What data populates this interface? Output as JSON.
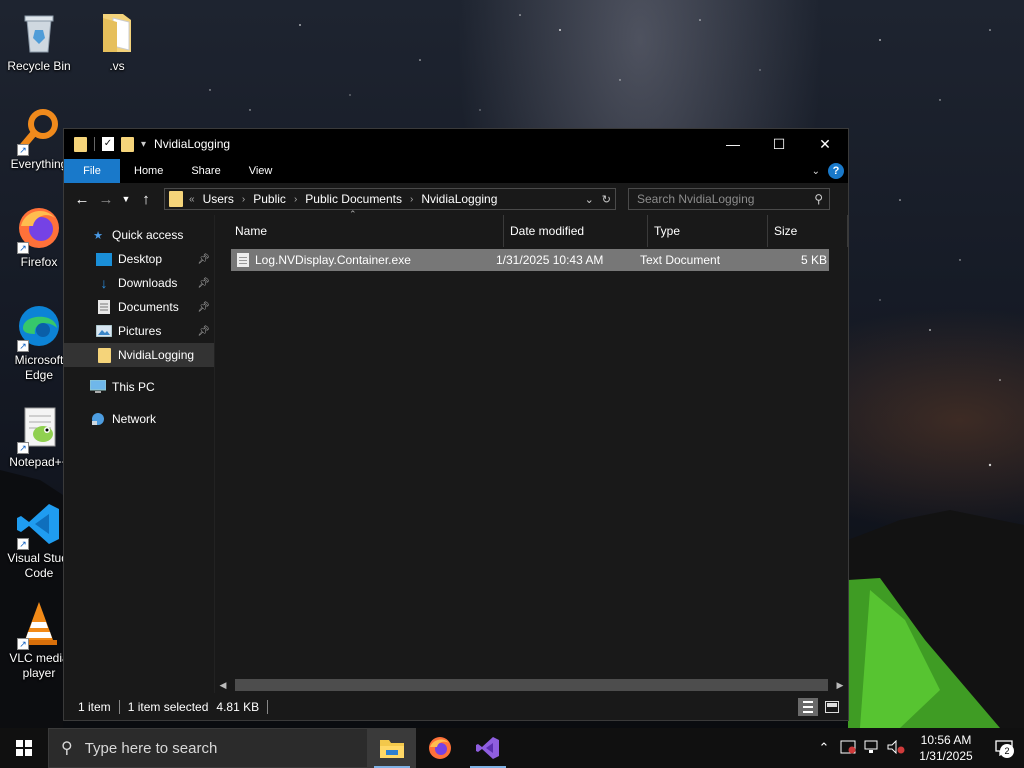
{
  "desktop": {
    "icons": [
      {
        "label": "Recycle Bin",
        "icon": "recycle-bin-icon"
      },
      {
        "label": ".vs",
        "icon": "folder-icon"
      },
      {
        "label": "Everything",
        "icon": "magnifier-icon"
      },
      {
        "label": "Firefox",
        "icon": "firefox-icon"
      },
      {
        "label": "Microsoft Edge",
        "label_line1": "Microsoft",
        "label_line2": "Edge",
        "icon": "edge-icon"
      },
      {
        "label": "Notepad++",
        "icon": "notepadpp-icon"
      },
      {
        "label": "Visual Studio Code",
        "label_line1": "Visual Studi",
        "label_line2": "Code",
        "icon": "vscode-icon"
      },
      {
        "label": "VLC media player",
        "label_line1": "VLC media",
        "label_line2": "player",
        "icon": "vlc-icon"
      }
    ]
  },
  "window": {
    "title": "NvidiaLogging",
    "controls": {
      "minimize": "—",
      "maximize": "☐",
      "close": "✕"
    }
  },
  "ribbon": {
    "tabs": [
      "File",
      "Home",
      "Share",
      "View"
    ],
    "help": "?"
  },
  "address_bar": {
    "overflow": "«",
    "path": [
      "Users",
      "Public",
      "Public Documents",
      "NvidiaLogging"
    ]
  },
  "search": {
    "placeholder": "Search NvidiaLogging"
  },
  "nav_pane": {
    "quick_access": "Quick access",
    "pinned": [
      {
        "label": "Desktop",
        "icon": "desktop-icon",
        "pinned": true
      },
      {
        "label": "Downloads",
        "icon": "downloads-icon",
        "pinned": true
      },
      {
        "label": "Documents",
        "icon": "documents-icon",
        "pinned": true
      },
      {
        "label": "Pictures",
        "icon": "pictures-icon",
        "pinned": true
      },
      {
        "label": "NvidiaLogging",
        "icon": "folder-icon",
        "pinned": false,
        "selected": true
      }
    ],
    "this_pc": "This PC",
    "network": "Network"
  },
  "file_list": {
    "columns": [
      "Name",
      "Date modified",
      "Type",
      "Size"
    ],
    "rows": [
      {
        "name": "Log.NVDisplay.Container.exe",
        "date_modified": "1/31/2025 10:43 AM",
        "type": "Text Document",
        "size": "5 KB",
        "selected": true
      }
    ]
  },
  "status_bar": {
    "item_count": "1 item",
    "selection": "1 item selected",
    "selection_size": "4.81 KB"
  },
  "taskbar": {
    "search_placeholder": "Type here to search",
    "apps": [
      "file-explorer-icon",
      "firefox-icon",
      "visual-studio-icon"
    ],
    "clock_time": "10:56 AM",
    "clock_date": "1/31/2025",
    "notification_count": "2"
  },
  "colors": {
    "accent": "#1979ca",
    "window_bg": "#191919",
    "selected_row": "#777777",
    "folder": "#f5d47a"
  }
}
